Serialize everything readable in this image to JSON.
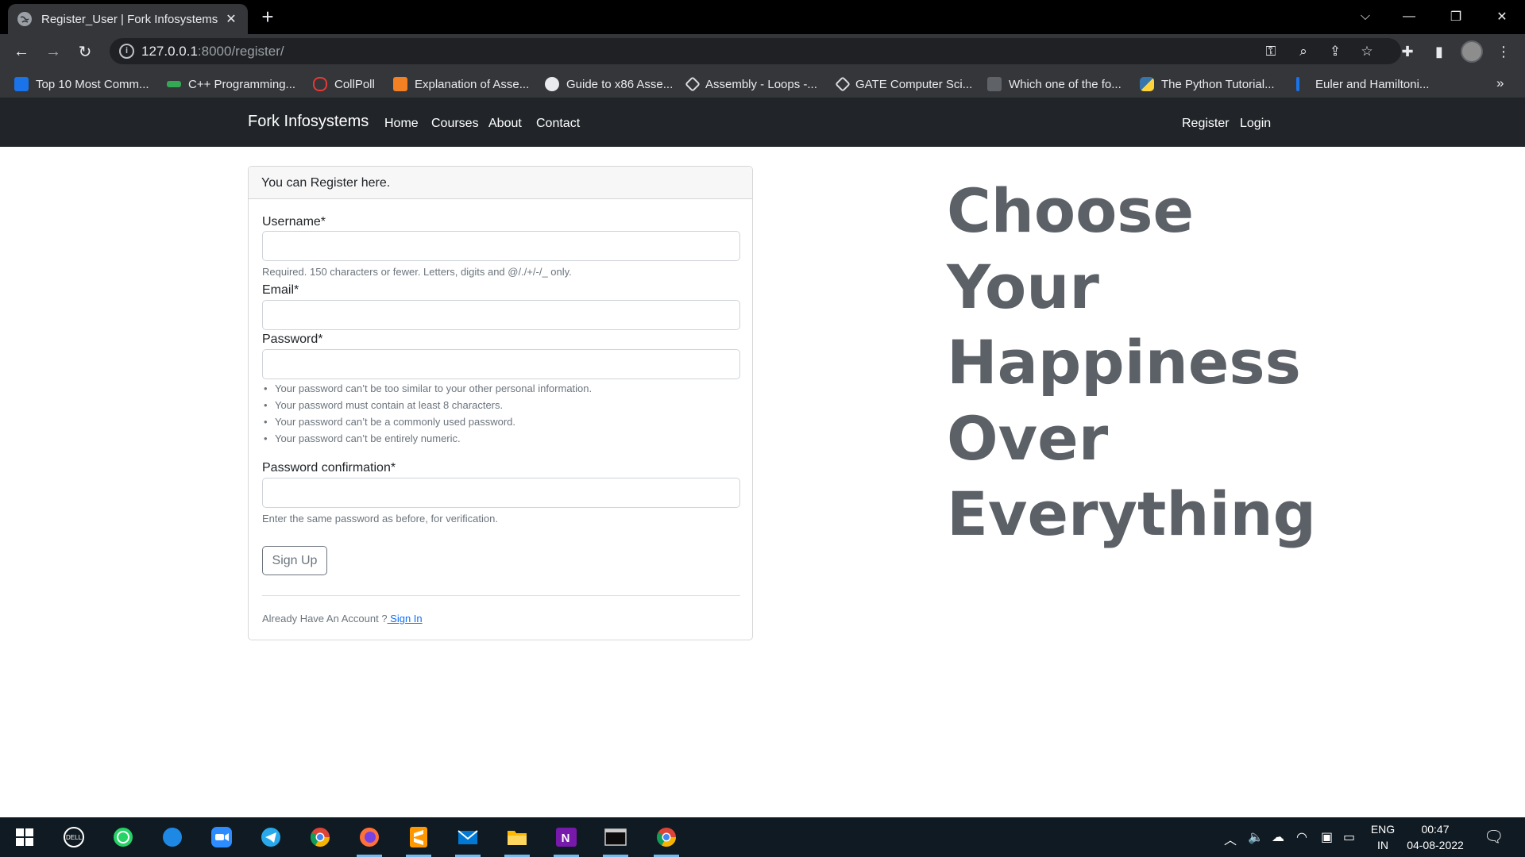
{
  "browser": {
    "tab_title": "Register_User | Fork Infosystems",
    "tab_close": "✕",
    "new_tab": "+",
    "url_host": "127.0.0.1",
    "url_path": ":8000/register/",
    "bookmarks": [
      {
        "label": "Top 10 Most Comm...",
        "icon": "bookmark-favicon-blue",
        "color": "#1a73e8"
      },
      {
        "label": "C++ Programming...",
        "icon": "bookmark-favicon-green",
        "color": "#34a853"
      },
      {
        "label": "CollPoll",
        "icon": "bookmark-favicon-red",
        "color": "#e53935"
      },
      {
        "label": "Explanation of Asse...",
        "icon": "bookmark-favicon-stack",
        "color": "#f48024"
      },
      {
        "label": "Guide to x86 Asse...",
        "icon": "bookmark-favicon-globe",
        "color": "#e8eaed"
      },
      {
        "label": "Assembly - Loops -...",
        "icon": "bookmark-favicon-tp",
        "color": "#dadce0"
      },
      {
        "label": "GATE Computer Sci...",
        "icon": "bookmark-favicon-gate",
        "color": "#dadce0"
      },
      {
        "label": "Which one of the fo...",
        "icon": "bookmark-favicon-doc",
        "color": "#5f6368"
      },
      {
        "label": "The Python Tutorial...",
        "icon": "bookmark-favicon-python",
        "color": "#3776ab"
      },
      {
        "label": "Euler and Hamiltoni...",
        "icon": "bookmark-favicon-bar",
        "color": "#1a73e8"
      }
    ]
  },
  "navbar": {
    "brand": "Fork Infosystems",
    "links": [
      "Home",
      "Courses",
      "About",
      "Contact"
    ],
    "right_links": [
      "Register",
      "Login"
    ]
  },
  "form": {
    "header": "You can Register here.",
    "username_label": "Username*",
    "username_value": "",
    "username_help": "Required. 150 characters or fewer. Letters, digits and @/./+/-/_ only.",
    "email_label": "Email*",
    "email_value": "",
    "password_label": "Password*",
    "password_value": "",
    "password_rules": [
      "Your password can’t be too similar to your other personal information.",
      "Your password must contain at least 8 characters.",
      "Your password can’t be a commonly used password.",
      "Your password can’t be entirely numeric."
    ],
    "confirm_label": "Password confirmation*",
    "confirm_value": "",
    "confirm_help": "Enter the same password as before, for verification.",
    "submit_label": "Sign Up",
    "already_text": "Already Have An Account ?",
    "sign_in_link": " Sign In"
  },
  "slogan": [
    "Choose",
    "Your",
    "Happiness",
    "Over",
    "Everything"
  ],
  "taskbar": {
    "apps": [
      "windows-start",
      "dell",
      "whatsapp",
      "safari",
      "zoom",
      "telegram",
      "chrome",
      "firefox",
      "sublime-text",
      "mail",
      "file-explorer",
      "onenote",
      "terminal",
      "chrome-active"
    ],
    "lang_1": "ENG",
    "lang_2": "IN",
    "time": "00:47",
    "date": "04-08-2022"
  },
  "colors": {
    "navbar_bg": "#212529",
    "slogan": "#5c6167",
    "link": "#0d6efd",
    "taskbar_bg": "#101a22"
  }
}
